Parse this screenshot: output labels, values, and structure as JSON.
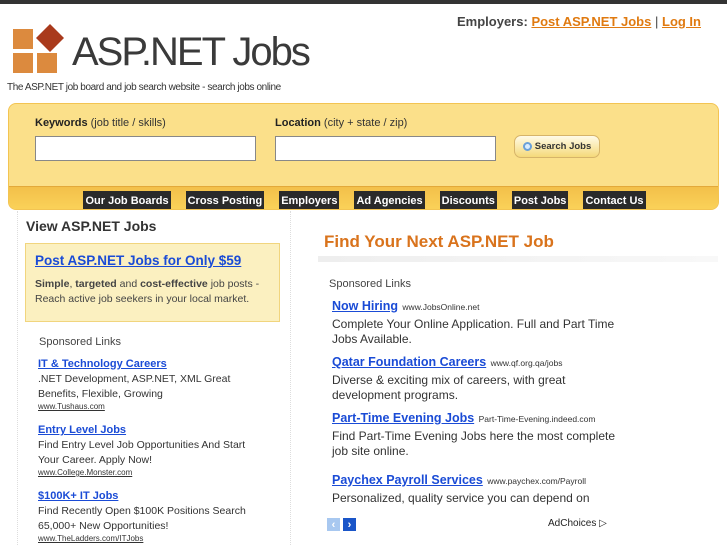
{
  "header": {
    "title": "ASP.NET Jobs",
    "tagline": "The ASP.NET job board and job search website - search jobs online",
    "employers_label": "Employers:",
    "post_link": "Post ASP.NET Jobs",
    "separator": "|",
    "login_link": "Log In"
  },
  "search": {
    "keywords_label": "Keywords",
    "keywords_hint": "(job title / skills)",
    "keywords_value": "",
    "location_label": "Location",
    "location_hint": "(city + state / zip)",
    "location_value": "",
    "button": "Search Jobs"
  },
  "nav": [
    "Our Job Boards",
    "Cross Posting",
    "Employers",
    "Ad Agencies",
    "Discounts",
    "Post Jobs",
    "Contact Us"
  ],
  "left": {
    "heading": "View ASP.NET Jobs",
    "promo_link": "Post ASP.NET Jobs for Only $59",
    "promo_b1": "Simple",
    "promo_t1": ", ",
    "promo_b2": "targeted",
    "promo_t2": " and ",
    "promo_b3": "cost-effective",
    "promo_t3": " job posts - Reach active job seekers in your local market.",
    "sponsored": "Sponsored Links",
    "ads": [
      {
        "title": "IT & Technology Careers",
        "desc": ".NET Development, ASP.NET, XML Great Benefits, Flexible, Growing",
        "url": "www.Tushaus.com"
      },
      {
        "title": "Entry Level Jobs",
        "desc": "Find Entry Level Job Opportunities And Start Your Career. Apply Now!",
        "url": "www.College.Monster.com"
      },
      {
        "title": "$100K+ IT Jobs",
        "desc": "Find Recently Open $100K Positions Search 65,000+ New Opportunities!",
        "url": "www.TheLadders.com/ITJobs"
      }
    ]
  },
  "main": {
    "heading": "Find Your Next ASP.NET Job",
    "sponsored": "Sponsored Links",
    "ads": [
      {
        "title": "Now Hiring",
        "url": "www.JobsOnline.net",
        "desc": "Complete Your Online Application. Full and Part Time Jobs Available."
      },
      {
        "title": "Qatar Foundation Careers",
        "url": "www.qf.org.qa/jobs",
        "desc": "Diverse & exciting mix of careers, with great development programs."
      },
      {
        "title": "Part-Time Evening Jobs",
        "url": "Part-Time-Evening.indeed.com",
        "desc": "Find Part-Time Evening Jobs here the most complete job site online."
      },
      {
        "title": "Paychex Payroll Services",
        "url": "www.paychex.com/Payroll",
        "desc": "Personalized, quality service you can depend on"
      }
    ],
    "adchoices": "AdChoices",
    "prev": "‹",
    "next": "›"
  }
}
